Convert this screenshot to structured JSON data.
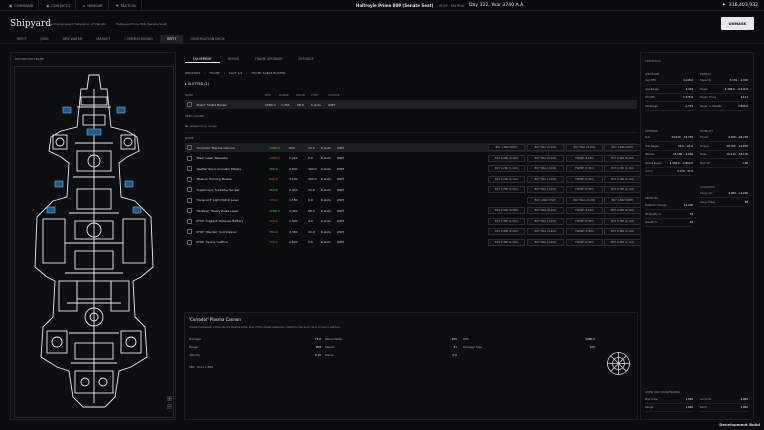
{
  "topbar": {
    "nav": [
      {
        "label": "COMMAND",
        "icon": "terminal-icon"
      },
      {
        "label": "CONTACTS",
        "icon": "contacts-icon"
      },
      {
        "label": "HANGAR",
        "icon": "hangar-icon"
      },
      {
        "label": "FACTION",
        "icon": "faction-icon"
      }
    ],
    "location": "Haltroyie Prime 809 (Senate Seat)",
    "region": "UFOP · MUTRIA",
    "date": "Day 322, Year 3740 A.A.",
    "credits": "316,403,932"
  },
  "header": {
    "title": "Shipyard",
    "subtitle_left": "The Unimpressed Federation of Planets",
    "subtitle_right": "Haltroyie Prime 809 (Senate Seat)",
    "unmask_label": "UNMASK"
  },
  "tabs": [
    "REFIT",
    "JOBS",
    "DRY WATER",
    "MARKET",
    "COMMISSIONING",
    "REFIT",
    "OBSERVATION DECK"
  ],
  "active_tab": 5,
  "left": {
    "label": "DESTROYER FRAME"
  },
  "subtabs": [
    "EQUIPMENT",
    "REPAIR",
    "FRAME UPGRADE",
    "REFORGE"
  ],
  "breadcrumb": [
    "WEAPONS",
    "FRONT",
    "SLOT 1/2",
    "FRONT SABLE BUSTER"
  ],
  "slotted": {
    "title": "▸ SLOTTED (1)",
    "headers": [
      "NAME",
      "DPS",
      "RANGE",
      "DRAIN",
      "TYPE",
      "SOURCE"
    ],
    "row": {
      "name": "'Prism' Shield Buster",
      "dps": "1980.0",
      "range": "1,356",
      "drain": "98.0",
      "type": "6 slots",
      "source": "UNIT"
    }
  },
  "empty_hint": "SPEC LOADS",
  "no_weapons": "No weapons in range",
  "weapons_header": "NAME",
  "weapons": [
    {
      "name": "'Corrodor' Plasma Cannon",
      "dps": "1980.0",
      "range": "832",
      "drain": "33.0",
      "type": "6 slots",
      "source": "UNIT",
      "b": [
        "BUY 1,890 (UNIT)",
        "BUY WILL (8,100)",
        "BUY WILL (8,100)",
        "BUY 1,890 (UNIT)"
      ],
      "sel": true
    },
    {
      "name": "'Maw' Laser Repeater",
      "dps": "1300.0",
      "range": "1,222",
      "drain": "0.0",
      "type": "6 slots",
      "source": "UNIT",
      "b": [
        "BUY 6,990 (8,100)",
        "BUY WILL (8,100)",
        "FRAME (8,100)",
        "BUY 6,990 (8,100)"
      ]
    },
    {
      "name": "'Jewfile' Sonic Acoustic Missile",
      "dps": "580.0",
      "range": "2,000",
      "drain": "400.0",
      "type": "6 slots",
      "source": "UNIT",
      "b": [
        "BUY 2,280 (1,110)",
        "BUY WILL (4,200)",
        "FRAME (3,300)",
        "BUY 2,280 (1,110)"
      ]
    },
    {
      "name": "'Baskus' Homing Missile",
      "dps": "640.0",
      "range": "3,100",
      "drain": "400.0",
      "type": "6 slots",
      "source": "UNIT",
      "b": [
        "BUY 2,280 (1,110)",
        "BUY WILL (4,200)",
        "FRAME (3,300)",
        "BUY 2,280 (1,110)"
      ]
    },
    {
      "name": "'Supernova' Sunfelter Rocket",
      "dps": "360.0",
      "range": "2,070",
      "drain": "25.0",
      "type": "6 slots",
      "source": "UNIT",
      "b": [
        "BUY 2,280 (1,110)",
        "BUY WILL (4,200)",
        "FRAME (3,300)",
        "BUY 2,280 (1,110)"
      ]
    },
    {
      "name": "'Vanguard' Light Patrol Laser",
      "dps": "130.0",
      "range": "1,160",
      "drain": "0.0",
      "type": "6 slots",
      "source": "UNIT",
      "b": [
        "",
        "BUY 1,890 (UNIT)",
        "BUY WILL (8,100)",
        "BUY 1,890 (UNIT)"
      ]
    },
    {
      "name": "'Sentinel' Heavy Pulse Laser",
      "dps": "3200.0",
      "range": "3,420",
      "drain": "88.0",
      "type": "6 slots",
      "source": "UNIT",
      "b": [
        "BUY 2,980 (8,100)",
        "BUY WILL (8,100)",
        "FRAME (8,100)",
        "BUY 2,980 (8,100)"
      ]
    },
    {
      "name": "UFOP 'Vigilant' Defense Battery",
      "dps": "100.0",
      "range": "1,500",
      "drain": "4.0",
      "type": "6 slots",
      "source": "UNIT",
      "b": [
        "BUY 2,480 (1,110)",
        "BUY WILL (4,200)",
        "FRAME (3,300)",
        "BUY 2,480 (1,110)"
      ]
    },
    {
      "name": "UFOP 'Warden' Coil Cannon",
      "dps": "780.0",
      "range": "2,380",
      "drain": "40.0",
      "type": "6 slots",
      "source": "UNIT",
      "b": [
        "BUY 2,480 (1,110)",
        "BUY WILL (4,200)",
        "FRAME (3,300)",
        "BUY 2,480 (1,110)"
      ]
    },
    {
      "name": "UFOP 'Sentry' Lattice",
      "dps": "250.0",
      "range": "1,620",
      "drain": "2.0",
      "type": "6 slots",
      "source": "UNIT",
      "b": [
        "BUY 2,480 (1,110)",
        "BUY WILL (4,200)",
        "FRAME (3,300)",
        "BUY 2,480 (1,110)"
      ]
    }
  ],
  "detail": {
    "title": "'Corrodor' Plasma Cannon",
    "desc": "A balanced weapon that shoots plasma bolts. One of the oldest weapons, crafted in the early days of space warfare.",
    "rows1": [
      {
        "k": "Damage",
        "v": "73.0"
      },
      {
        "k": "Range",
        "v": "908"
      },
      {
        "k": "Velocity",
        "v": "3.10"
      }
    ],
    "rows2": [
      {
        "k": "Reload Rate",
        "v": "100"
      },
      {
        "k": "Speed",
        "v": "31"
      },
      {
        "k": "Pierce",
        "v": "0.0"
      }
    ],
    "rows3": [
      {
        "k": "DPS",
        "v": "1980.0"
      },
      {
        "k": "Damage Type",
        "v": "100"
      }
    ],
    "source_label": "SRC",
    "source_value": "Price 1,890"
  },
  "right": {
    "header": "STATISTICS",
    "weapons_label": "WEAPONS",
    "energy_label": "ENERGY",
    "defense_label": "DEFENSE",
    "mobility_label": "MOBILITY",
    "sensors_label": "SENSORS",
    "logistics_label": "LOGISTICS",
    "weapons": [
      {
        "k": "Avg DPS",
        "v": "4,148.0",
        "c": "pos"
      },
      {
        "k": "Avg Range",
        "v": "1,419",
        "c": "pos"
      },
      {
        "k": "DR DPS",
        "v": "-1,275.0",
        "c": "neg"
      },
      {
        "k": "DR Range",
        "v": "-1,379",
        "c": "neg"
      }
    ],
    "energy": [
      {
        "k": "Capacity",
        "v": "3,131 · -1,300",
        "c": "pos"
      },
      {
        "k": "Regen",
        "v": "1,390.0 · -3,212.0",
        "c": ""
      },
      {
        "k": "Regen Firing",
        "v": "1,111",
        "c": ""
      },
      {
        "k": "Regen in Shields",
        "v": "3,800.0",
        "c": ""
      }
    ],
    "defense": [
      {
        "k": "Hull",
        "v": "23,979 · -32,370",
        "c": "pos"
      },
      {
        "k": "Hull Regen",
        "v": "54.0 · -61.0",
        "c": ""
      },
      {
        "k": "Shields",
        "v": "15,000 · -3,930",
        "c": "pos"
      },
      {
        "k": "Shield Regen",
        "v": "2,950.0 · -1,650.0",
        "c": ""
      },
      {
        "k": "Armor",
        "v": "0.270 · 37.0",
        "c": ""
      }
    ],
    "mobility": [
      {
        "k": "Thrust",
        "v": "4,400 · -26,720",
        "c": "pos"
      },
      {
        "k": "Torque",
        "v": "28,700 · -41,870",
        "c": ""
      },
      {
        "k": "Mass",
        "v": "16,310 · -35,100",
        "c": ""
      },
      {
        "k": "Max Vel",
        "v": "1.06",
        "c": ""
      }
    ],
    "logistics": [
      {
        "k": "Cargo Vol",
        "v": "1,000 · +1,000",
        "c": ""
      },
      {
        "k": "Cargo Mass",
        "v": "80",
        "c": ""
      }
    ],
    "sensors": [
      {
        "k": "Detection Range",
        "v": "10,000",
        "c": ""
      },
      {
        "k": "ID Quality %",
        "v": "70",
        "c": ""
      },
      {
        "k": "Stealth %",
        "v": "20",
        "c": ""
      }
    ],
    "footer_label": "CREW AND PASSENGERS",
    "footer": [
      {
        "k": "Max Crew",
        "v": "1,000",
        "k2": "Accomm.",
        "v2": "1,000"
      },
      {
        "k": "Range",
        "v": "1,000",
        "k2": "Berth",
        "v2": "1,000"
      }
    ]
  },
  "footer": {
    "dev_build": "Development Build"
  },
  "colors": {
    "accent": "#e6e8eb",
    "positive": "#63c46b",
    "negative": "#e0604d",
    "background": "#0b0c0e"
  }
}
